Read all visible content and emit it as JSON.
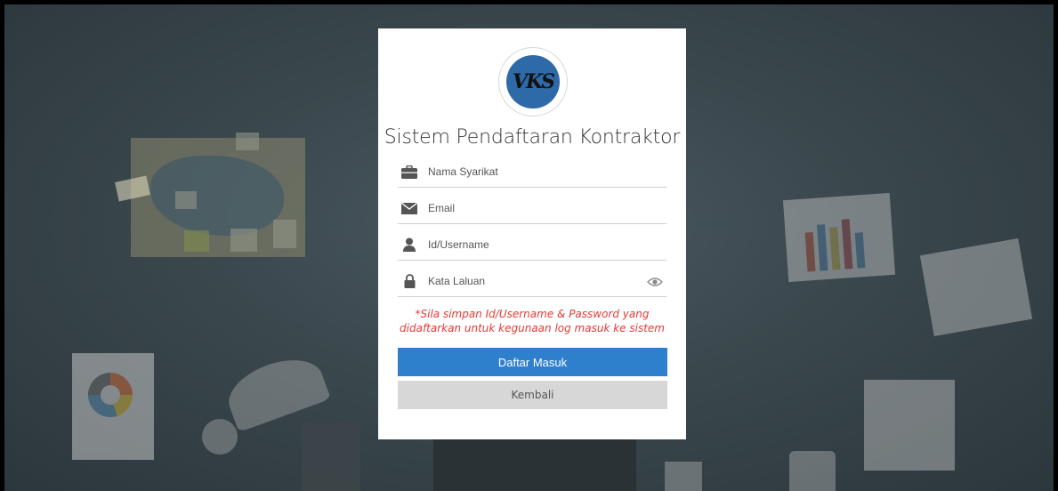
{
  "logo": {
    "text": "VKS"
  },
  "title": "Sistem Pendaftaran Kontraktor",
  "form": {
    "company": {
      "placeholder": "Nama Syarikat",
      "icon": "briefcase-icon"
    },
    "email": {
      "placeholder": "Email",
      "icon": "envelope-icon"
    },
    "username": {
      "placeholder": "Id/Username",
      "icon": "user-icon"
    },
    "password": {
      "placeholder": "Kata Laluan",
      "icon": "lock-icon",
      "toggle_icon": "eye-icon"
    }
  },
  "note": {
    "line1": "*Sila simpan Id/Username & Password yang",
    "line2": "didaftarkan untuk kegunaan log masuk ke sistem"
  },
  "buttons": {
    "register": "Daftar Masuk",
    "back": "Kembali"
  },
  "colors": {
    "primary": "#2f80cc",
    "secondary": "#d7d7d7",
    "note": "#e53935",
    "background": "#3a474d"
  }
}
